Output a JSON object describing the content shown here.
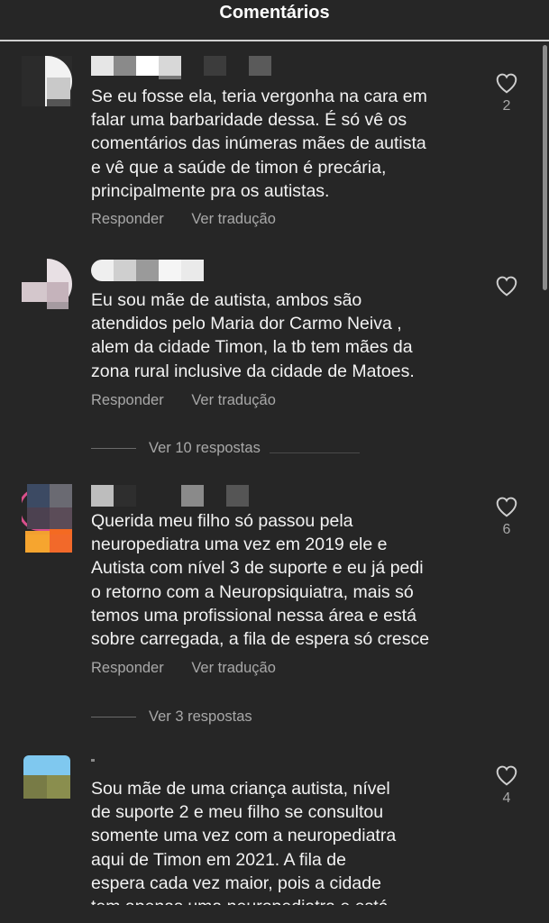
{
  "header": {
    "title": "Comentários"
  },
  "comments": [
    {
      "text": "Se eu fosse ela, teria vergonha na cara em\nfalar uma barbaridade dessa. É só vê os\ncomentários das inúmeras mães de autista\ne vê que a saúde de timon é precária,\nprincipalmente pra os autistas.",
      "reply_label": "Responder",
      "translate_label": "Ver tradução",
      "likes": "2"
    },
    {
      "text": "Eu sou mãe de autista, ambos são\natendidos pelo Maria dor Carmo Neiva ,\nalem da cidade Timon, la tb tem mães da\nzona rural inclusive da cidade de Matoes.",
      "reply_label": "Responder",
      "translate_label": "Ver tradução",
      "likes": "",
      "view_replies": "Ver 10 respostas"
    },
    {
      "text": "Querida meu filho só passou pela\nneuropediatra uma vez em 2019 ele e\nAutista com nível 3 de suporte e eu já pedi\no retorno com a Neuropsiquiatra, mais só\ntemos uma profissional nessa área e está\nsobre carregada, a fila de espera só cresce",
      "reply_label": "Responder",
      "translate_label": "Ver tradução",
      "likes": "6",
      "view_replies": "Ver 3 respostas"
    },
    {
      "text": "Sou mãe de uma criança autista, nível\nde suporte 2 e meu filho se consultou\nsomente uma vez com a neuropediatra\naqui de Timon em 2021. A fila de\nespera cada vez maior, pois a cidade\ntem apenas uma neuropediatra e está",
      "likes": "4"
    }
  ],
  "icons": {
    "like": "heart-outline-icon"
  },
  "colors": {
    "background": "#262626",
    "text": "#f2f2f2",
    "muted": "#a8a8a8"
  }
}
